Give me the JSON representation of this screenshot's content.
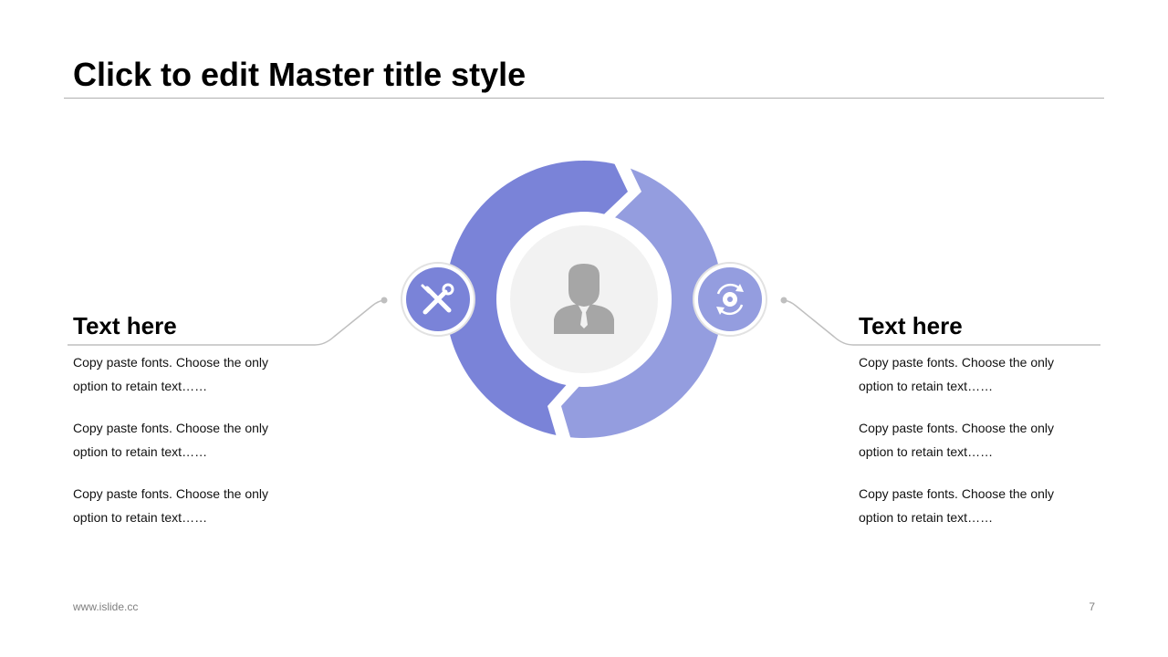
{
  "slide": {
    "title": "Click to edit Master title style"
  },
  "diagram": {
    "center": {
      "icon": "businessman-icon"
    },
    "left_node": {
      "icon": "tools-icon"
    },
    "right_node": {
      "icon": "gear-cycle-icon"
    }
  },
  "left_panel": {
    "heading": "Text here",
    "paragraphs": [
      [
        "Copy paste fonts. Choose the only",
        "option to retain text……"
      ],
      [
        "Copy paste fonts. Choose the only",
        "option to retain text……"
      ],
      [
        "Copy paste fonts. Choose the only",
        "option to retain text……"
      ]
    ]
  },
  "right_panel": {
    "heading": "Text here",
    "paragraphs": [
      [
        "Copy paste fonts. Choose the only",
        "option to retain text……"
      ],
      [
        "Copy paste fonts. Choose the only",
        "option to retain text……"
      ],
      [
        "Copy paste fonts. Choose the only",
        "option to retain text……"
      ]
    ]
  },
  "footer": {
    "url": "www.islide.cc",
    "page_number": "7"
  },
  "colors": {
    "arc_left": "#7a83d8",
    "arc_right": "#949ddf",
    "center_fill": "#f2f2f2",
    "person_icon": "#a6a6a6",
    "connector": "#bfbfbf",
    "title_rule": "#b0b0b0"
  }
}
